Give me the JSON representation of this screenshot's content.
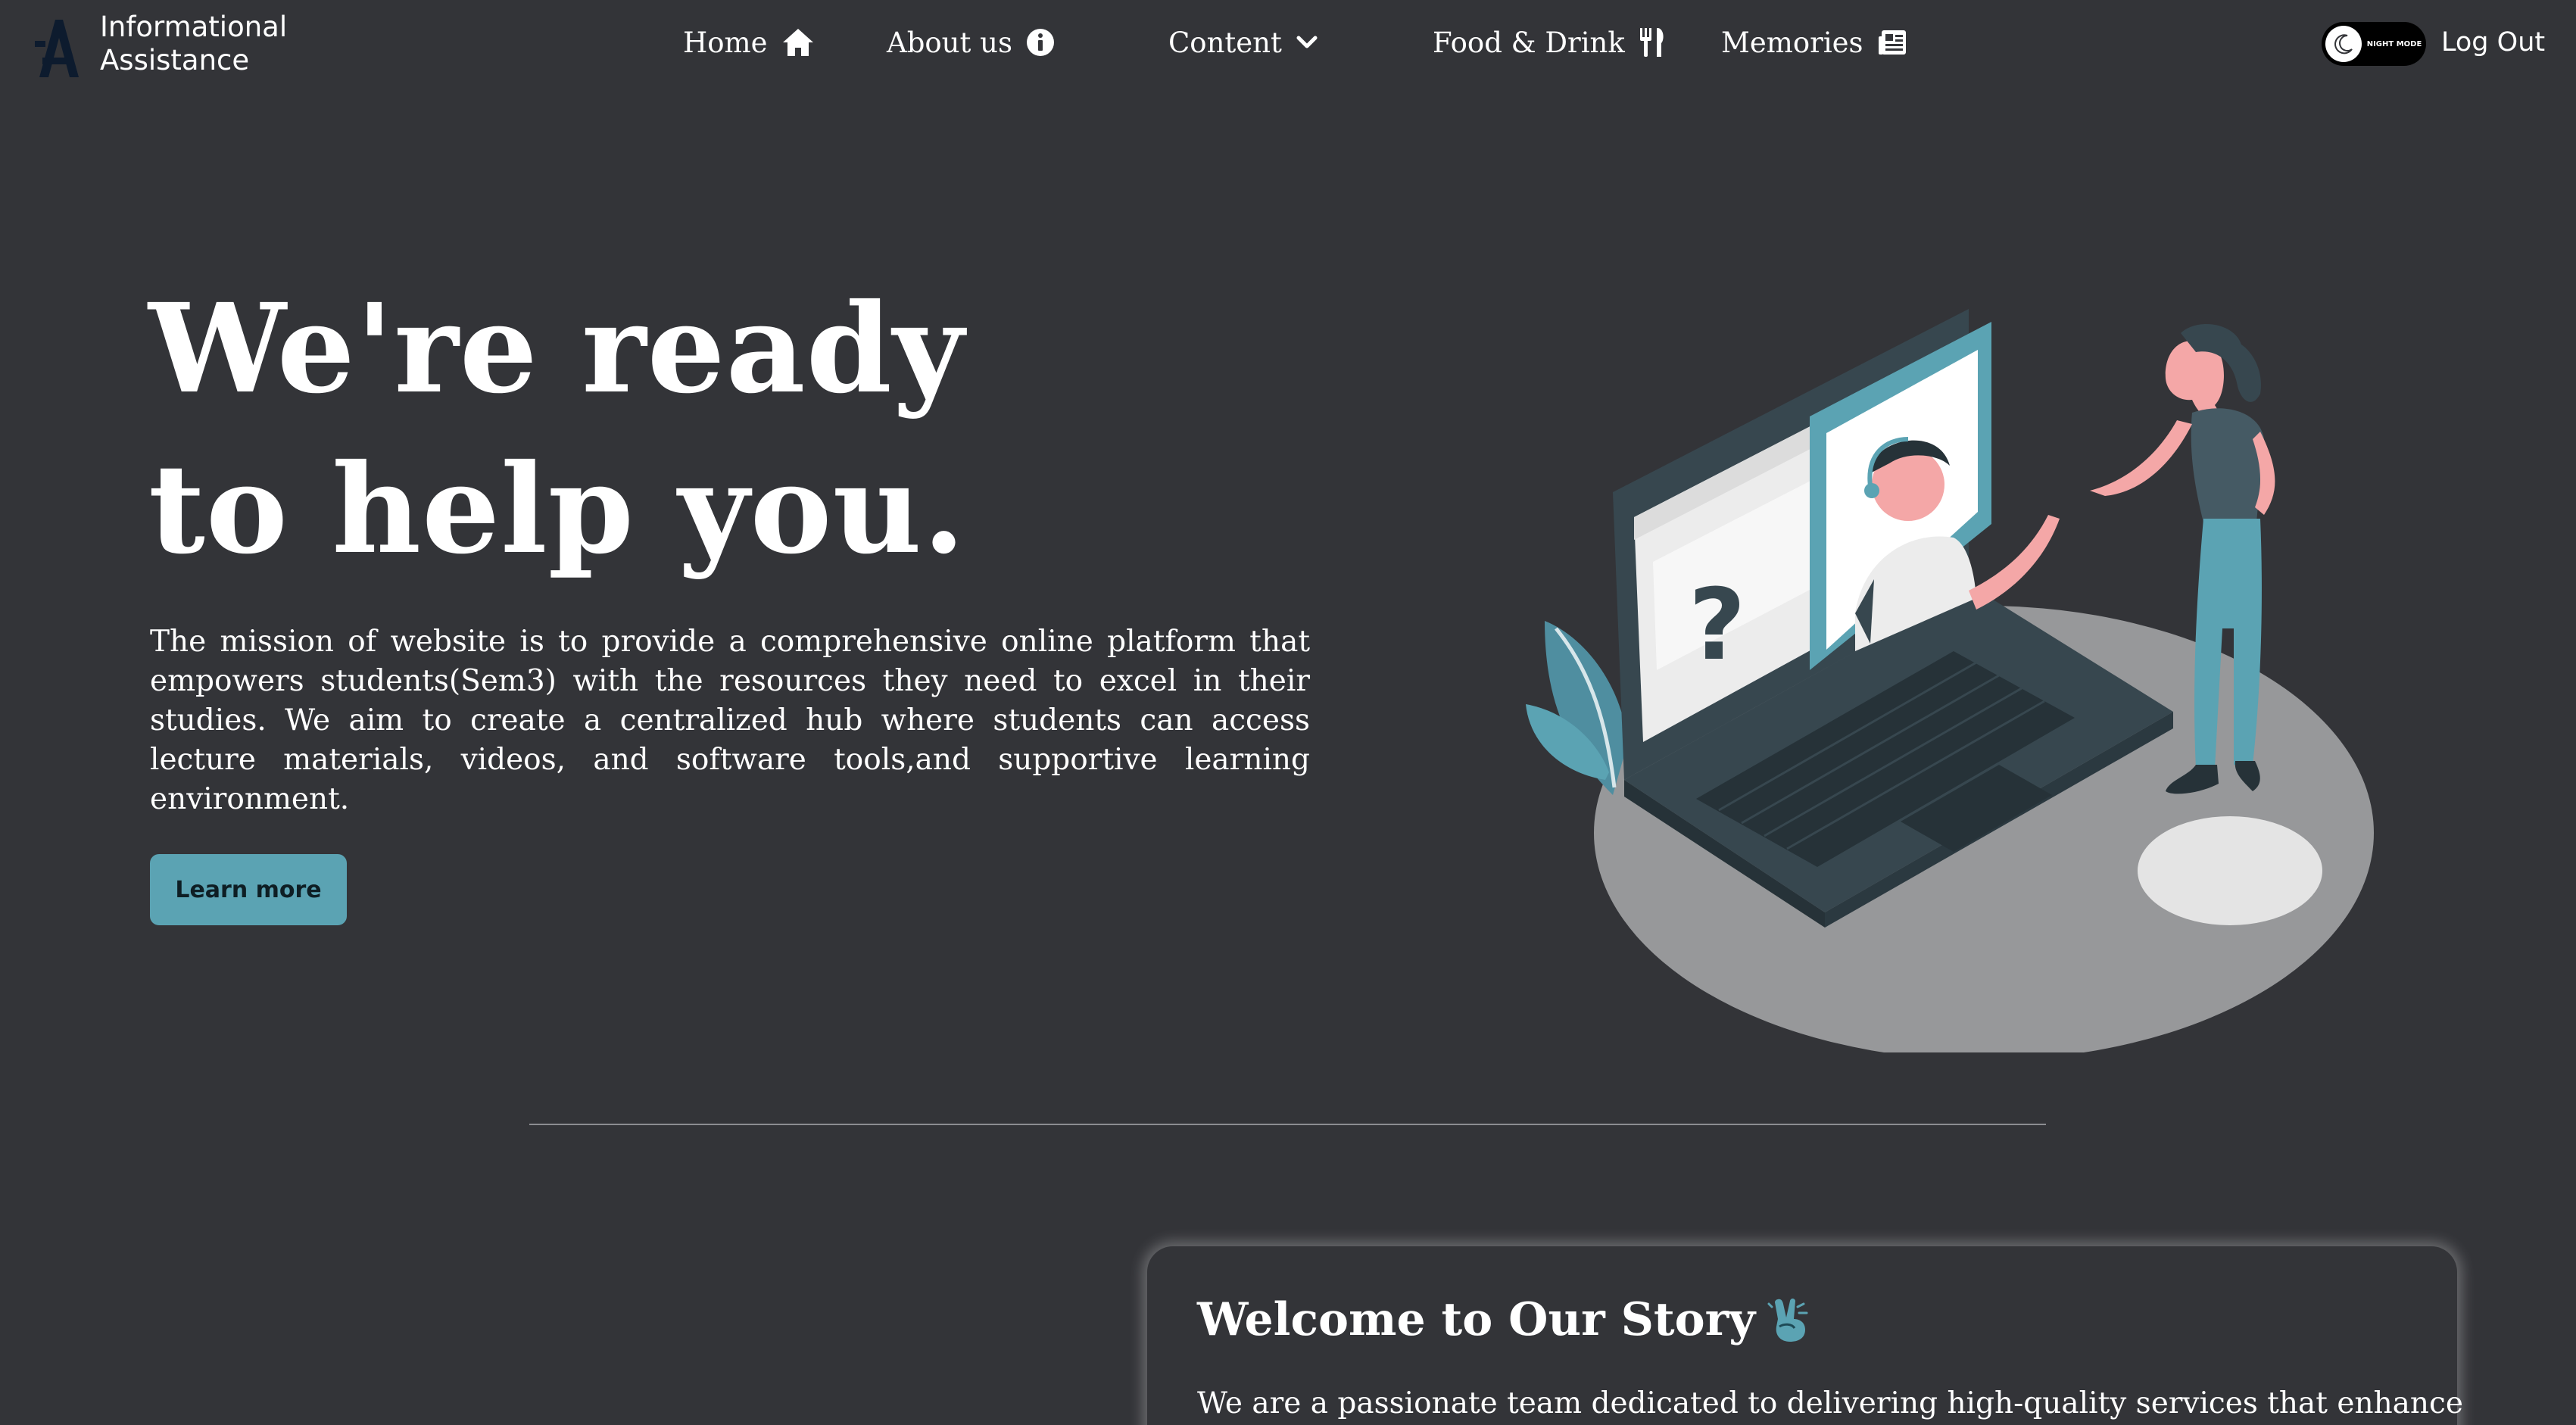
{
  "brand": {
    "name": "Informational\nAssistance"
  },
  "nav": {
    "home": "Home",
    "about": "About us",
    "content": "Content",
    "food": "Food & Drink",
    "memories": "Memories",
    "night_mode": "NIGHT MODE",
    "logout": "Log Out"
  },
  "hero": {
    "title_line1": "We're ready",
    "title_line2": "to help you.",
    "description": "The mission of website is to provide a comprehensive online platform that empowers students(Sem3) with the resources they need to excel in their studies. We aim to create a centralized hub where students can access lecture materials, videos, and software tools,and supportive learning environment.",
    "cta": "Learn more",
    "illustration_text": "?"
  },
  "story": {
    "title": "Welcome to Our Story",
    "body": "We are a passionate team dedicated to delivering high-quality services that enhance"
  },
  "colors": {
    "background": "#333438",
    "accent": "#5ba3b3",
    "text": "#ffffff",
    "toggle": "#000000"
  },
  "icons": {
    "logo": "logo-a-icon",
    "home": "house-icon",
    "about": "info-circle-icon",
    "content": "chevron-down-icon",
    "food": "fork-knife-icon",
    "memories": "newspaper-icon",
    "night_mode": "moon-icon",
    "story": "victory-hand-icon"
  }
}
